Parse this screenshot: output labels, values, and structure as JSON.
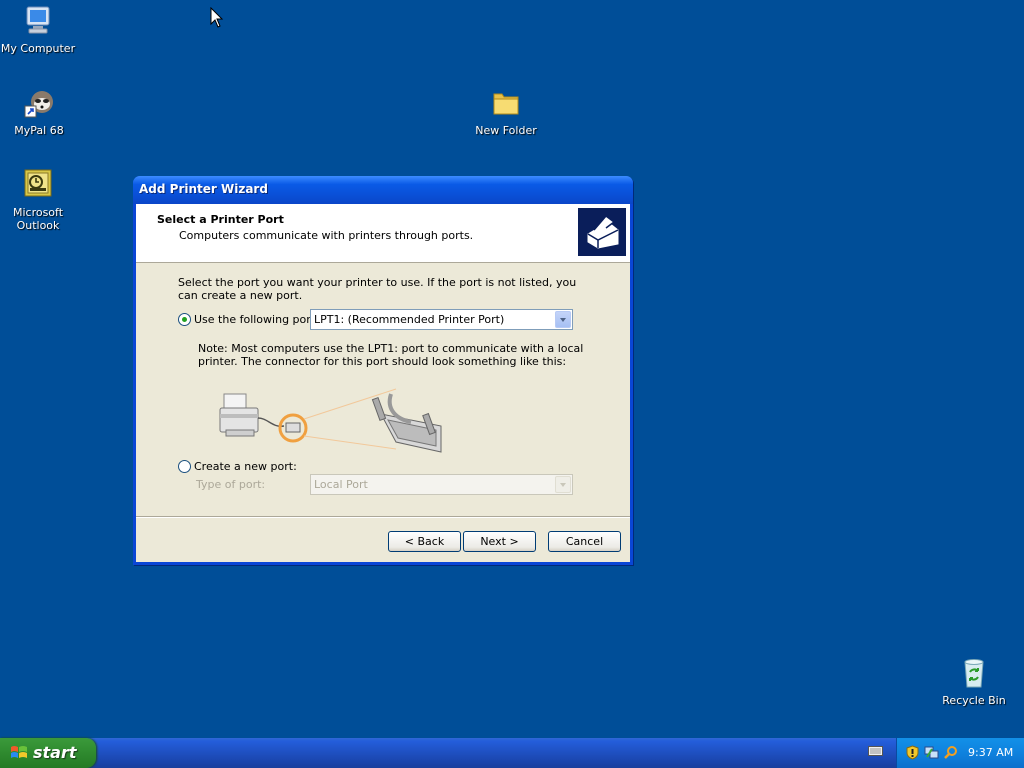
{
  "desktop": {
    "icons": [
      {
        "label": "My Computer"
      },
      {
        "label": "MyPal 68"
      },
      {
        "label": "Microsoft Outlook"
      },
      {
        "label": "New Folder"
      },
      {
        "label": "Recycle Bin"
      }
    ]
  },
  "window": {
    "title": "Add Printer Wizard",
    "header": {
      "title": "Select a Printer Port",
      "subtitle": "Computers communicate with printers through ports.",
      "icon": "printer-icon"
    },
    "intro": "Select the port you want your printer to use.  If the port is not listed, you can create a new port.",
    "use_port": {
      "label": "Use the following port:",
      "selected": true,
      "value": "LPT1: (Recommended Printer Port)"
    },
    "note": "Note: Most computers use the LPT1: port to communicate with a local printer. The connector for this port should look something like this:",
    "create_port": {
      "label": "Create a new port:",
      "selected": false,
      "type_label": "Type of port:",
      "type_value": "Local Port"
    },
    "buttons": {
      "back": "< Back",
      "next": "Next >",
      "cancel": "Cancel"
    }
  },
  "taskbar": {
    "start_label": "start",
    "clock": "9:37 AM",
    "tray_icons": [
      "security-shield-icon",
      "network-icon",
      "search-icon"
    ],
    "keyboard_icon": "keyboard-icon"
  },
  "colors": {
    "desktop": "#004e98",
    "title_bar": "#0a5ae6",
    "dialog_bg": "#ece9d8",
    "start_button": "#2f8a2f",
    "tray": "#0f82de"
  }
}
